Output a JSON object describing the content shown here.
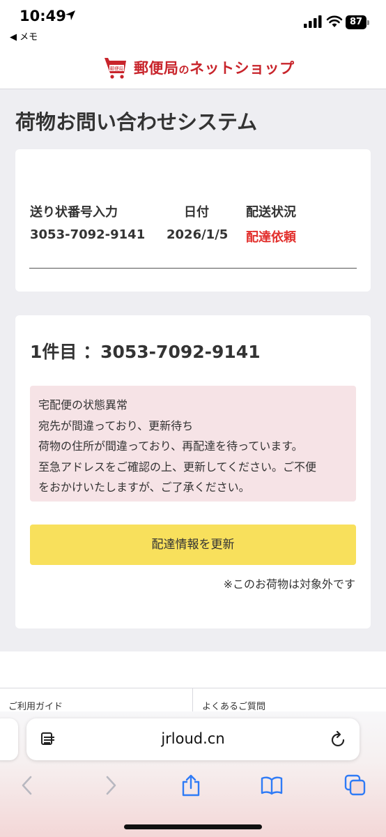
{
  "status_bar": {
    "time": "10:49",
    "back_label": "◀ メモ",
    "battery": "87"
  },
  "header": {
    "logo_main": "郵便局",
    "logo_no": "の",
    "logo_shop": "ネットショップ",
    "cart_label": "郵便局"
  },
  "page": {
    "title": "荷物お問い合わせシステム"
  },
  "summary": {
    "headers": [
      "送り状番号入力",
      "日付",
      "配送状況"
    ],
    "tracking_number": "3053-7092-9141",
    "date": "2026/1/5",
    "status": "配達依頼"
  },
  "detail": {
    "item_title": "1件目 ：3053-7092-9141",
    "alert_lines": [
      "宅配便の状態異常",
      "宛先が間違っており、更新待ち",
      "荷物の住所が間違っており、再配達を待っています。",
      "至急アドレスをご確認の上、更新してください。ご不便",
      "をおかけいたしますが、ご了承ください。"
    ],
    "button_label": "配達情報を更新",
    "note": "※このお荷物は対象外です"
  },
  "footer": {
    "links": [
      "ご利用ガイド",
      "よくあるご質問"
    ]
  },
  "browser": {
    "url": "jrloud.cn"
  },
  "colors": {
    "accent_red": "#e2302d",
    "logo_red": "#c8242b",
    "button_yellow": "#f8e05c",
    "alert_pink": "#f6e3e6",
    "page_grey": "#eeeef2",
    "link_blue": "#2f7bf6"
  }
}
